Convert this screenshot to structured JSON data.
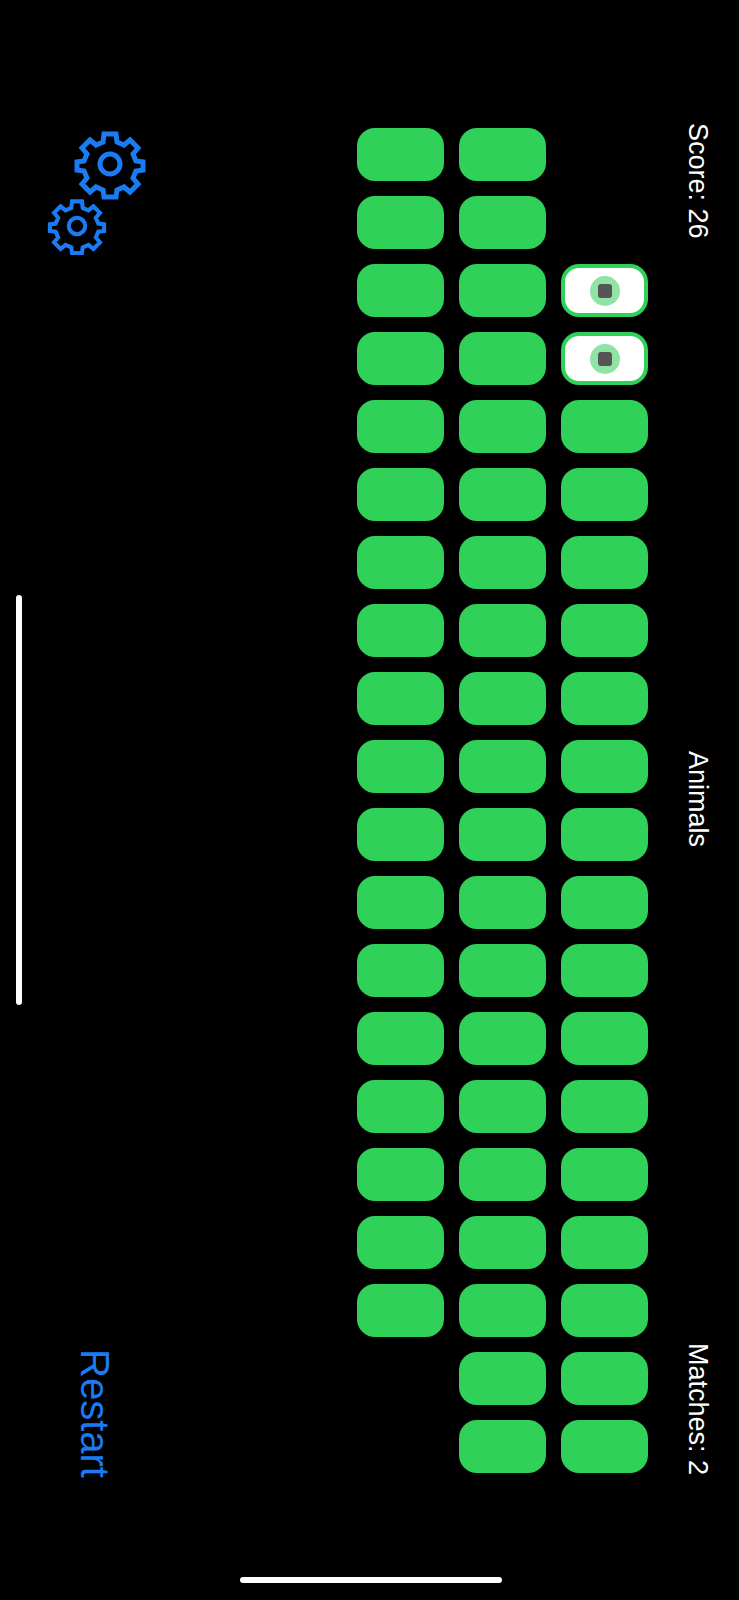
{
  "score": "Score: 26",
  "theme": "Animals",
  "matches": "Matches: 2",
  "restart": "Restart",
  "columns": [
    {
      "cards": [
        {
          "state": "face-down"
        },
        {
          "state": "face-down"
        },
        {
          "state": "face-down"
        },
        {
          "state": "face-down"
        },
        {
          "state": "face-down"
        },
        {
          "state": "face-down"
        },
        {
          "state": "face-down"
        },
        {
          "state": "face-down"
        },
        {
          "state": "face-down"
        },
        {
          "state": "face-down"
        },
        {
          "state": "face-down"
        },
        {
          "state": "face-down"
        },
        {
          "state": "face-down"
        },
        {
          "state": "face-down"
        },
        {
          "state": "face-down"
        },
        {
          "state": "face-down"
        },
        {
          "state": "face-down"
        },
        {
          "state": "face-down"
        },
        {
          "state": "matched"
        },
        {
          "state": "matched"
        }
      ]
    },
    {
      "cards": [
        {
          "state": "face-down"
        },
        {
          "state": "face-down"
        },
        {
          "state": "face-down"
        },
        {
          "state": "face-down"
        },
        {
          "state": "face-down"
        },
        {
          "state": "face-down"
        },
        {
          "state": "face-down"
        },
        {
          "state": "face-down"
        },
        {
          "state": "face-down"
        },
        {
          "state": "face-down"
        },
        {
          "state": "face-down"
        },
        {
          "state": "face-down"
        },
        {
          "state": "face-down"
        },
        {
          "state": "face-down"
        },
        {
          "state": "face-down"
        },
        {
          "state": "face-down"
        },
        {
          "state": "face-down"
        },
        {
          "state": "face-down"
        },
        {
          "state": "face-down"
        },
        {
          "state": "face-down"
        }
      ]
    },
    {
      "cards": [
        {
          "state": "matched"
        },
        {
          "state": "matched"
        },
        {
          "state": "face-up"
        },
        {
          "state": "face-up"
        },
        {
          "state": "face-down"
        },
        {
          "state": "face-down"
        },
        {
          "state": "face-down"
        },
        {
          "state": "face-down"
        },
        {
          "state": "face-down"
        },
        {
          "state": "face-down"
        },
        {
          "state": "face-down"
        },
        {
          "state": "face-down"
        },
        {
          "state": "face-down"
        },
        {
          "state": "face-down"
        },
        {
          "state": "face-down"
        },
        {
          "state": "face-down"
        },
        {
          "state": "face-down"
        },
        {
          "state": "face-down"
        },
        {
          "state": "face-down"
        },
        {
          "state": "face-down"
        }
      ]
    }
  ]
}
